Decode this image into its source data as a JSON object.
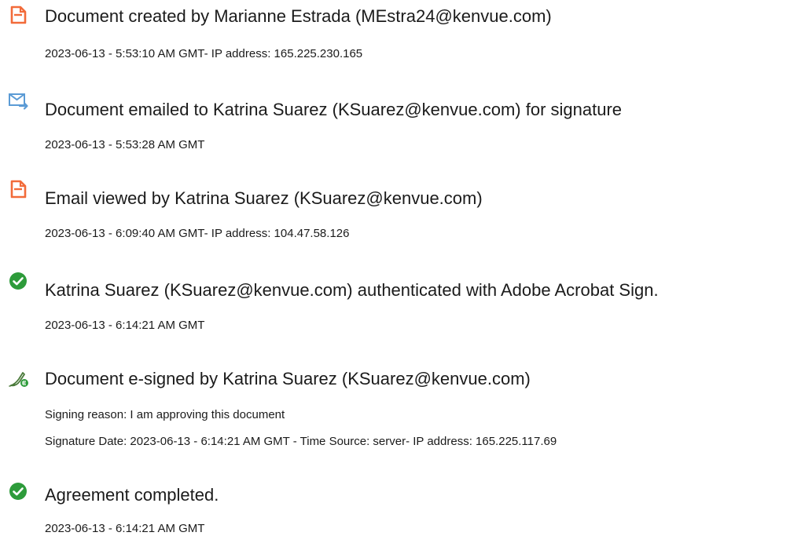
{
  "events": [
    {
      "icon": "document-created-icon",
      "title": "Document created by Marianne Estrada (MEstra24@kenvue.com)",
      "details": [
        "2023-06-13 - 5:53:10 AM GMT- IP address: 165.225.230.165"
      ]
    },
    {
      "icon": "email-sent-icon",
      "title": "Document emailed to Katrina Suarez (KSuarez@kenvue.com) for signature",
      "details": [
        "2023-06-13 - 5:53:28 AM GMT"
      ]
    },
    {
      "icon": "email-viewed-icon",
      "title": "Email viewed by Katrina Suarez (KSuarez@kenvue.com)",
      "details": [
        "2023-06-13 - 6:09:40 AM GMT- IP address: 104.47.58.126"
      ]
    },
    {
      "icon": "checkmark-circle-icon",
      "title": "Katrina Suarez (KSuarez@kenvue.com) authenticated with Adobe Acrobat Sign.",
      "details": [
        "2023-06-13 - 6:14:21 AM GMT"
      ]
    },
    {
      "icon": "pen-signature-icon",
      "title": "Document e-signed by Katrina Suarez (KSuarez@kenvue.com)",
      "details": [
        "Signing reason: I am approving this document",
        "Signature Date: 2023-06-13 - 6:14:21 AM GMT - Time Source: server- IP address: 165.225.117.69"
      ]
    },
    {
      "icon": "checkmark-circle-icon",
      "title": "Agreement completed.",
      "details": [
        "2023-06-13 - 6:14:21 AM GMT"
      ]
    }
  ],
  "colors": {
    "document_icon": "#f26b3a",
    "email_icon": "#5b9bd5",
    "check_icon": "#2d9b3a",
    "pen_icon": "#4a7a3a",
    "text": "#1b1b1b"
  }
}
